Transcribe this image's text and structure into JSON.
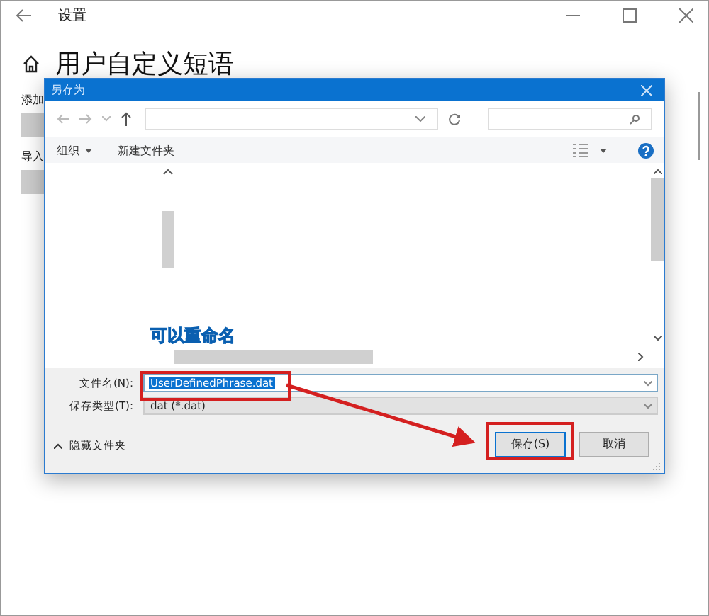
{
  "window": {
    "title": "设置"
  },
  "page": {
    "title": "用户自定义短语",
    "sections": [
      {
        "label": "添加"
      },
      {
        "label": "导入"
      }
    ]
  },
  "dialog": {
    "title": "另存为",
    "toolbar": [
      {
        "label": "组织",
        "kind": "menu"
      },
      {
        "label": "新建文件夹",
        "kind": "button"
      }
    ],
    "file_name": {
      "label": "文件名(N):",
      "value": "UserDefinedPhrase.dat",
      "selected": true
    },
    "file_type": {
      "label": "保存类型(T):",
      "value": "dat (*.dat)"
    },
    "hide_folders": "隐藏文件夹",
    "buttons": [
      {
        "label": "保存(S)",
        "default": true
      },
      {
        "label": "取消",
        "default": false
      }
    ]
  },
  "annotation": {
    "callout": "可以重命名"
  }
}
